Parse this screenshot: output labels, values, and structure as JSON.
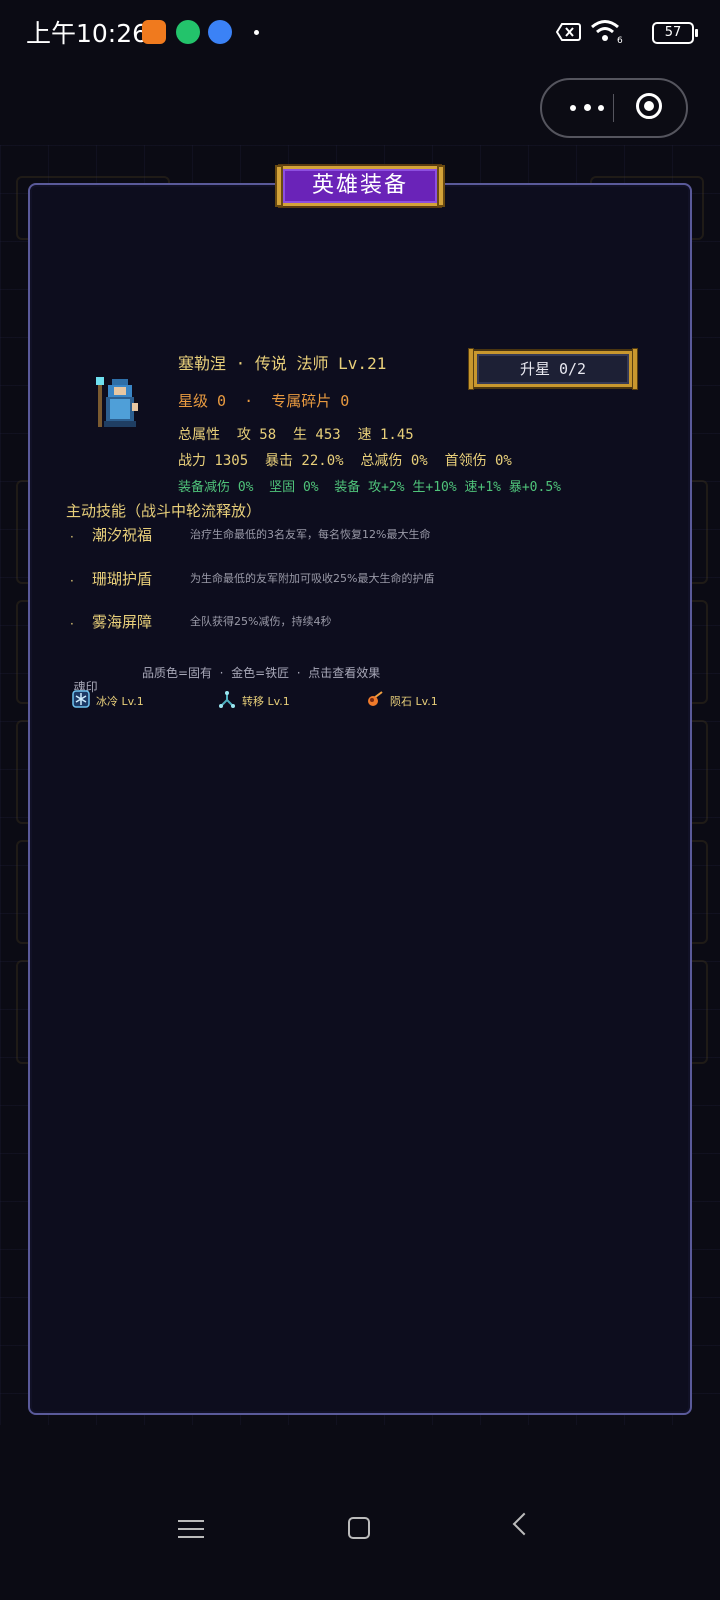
{
  "status": {
    "time": "上午10:26",
    "battery": "57"
  },
  "panel": {
    "title": "英雄装备"
  },
  "hero": {
    "name_line": "塞勒涅 · 传说 法师 Lv.21",
    "star_line": "星级 0  ·  专属碎片 0",
    "stats_line1": "总属性  攻 58  生 453  速 1.45",
    "stats_line2": "战力 1305  暴击 22.0%  总减伤 0%  首领伤 0%",
    "stats_line3": "装备减伤 0%  坚固 0%  装备 攻+2% 生+10% 速+1% 暴+0.5%",
    "upstar_label": "升星 0/2"
  },
  "skills": {
    "title": "主动技能（战斗中轮流释放）",
    "items": [
      {
        "bullet": "·",
        "name": "潮汐祝福",
        "desc": "治疗生命最低的3名友军，每名恢复12%最大生命"
      },
      {
        "bullet": "·",
        "name": "珊瑚护盾",
        "desc": "为生命最低的友军附加可吸收25%最大生命的护盾"
      },
      {
        "bullet": "·",
        "name": "雾海屏障",
        "desc": "全队获得25%减伤，持续4秒"
      }
    ]
  },
  "soul": {
    "label": "魂印",
    "hint": "品质色=固有  ·  金色=铁匠  ·  点击查看效果",
    "items": [
      {
        "name": "冰冷 Lv.1",
        "icon": "ice-crystal-icon",
        "color": "#6fc3f0"
      },
      {
        "name": "转移 Lv.1",
        "icon": "transfer-rune-icon",
        "color": "#4fb0c0"
      },
      {
        "name": "陨石 Lv.1",
        "icon": "meteor-icon",
        "color": "#f07a2a"
      }
    ]
  },
  "colors": {
    "accent_purple": "#6a23b8",
    "frame_gold": "#d3a33a",
    "text_gold": "#e8cf7a",
    "text_orange": "#e89a40",
    "text_green": "#4fc37a"
  }
}
